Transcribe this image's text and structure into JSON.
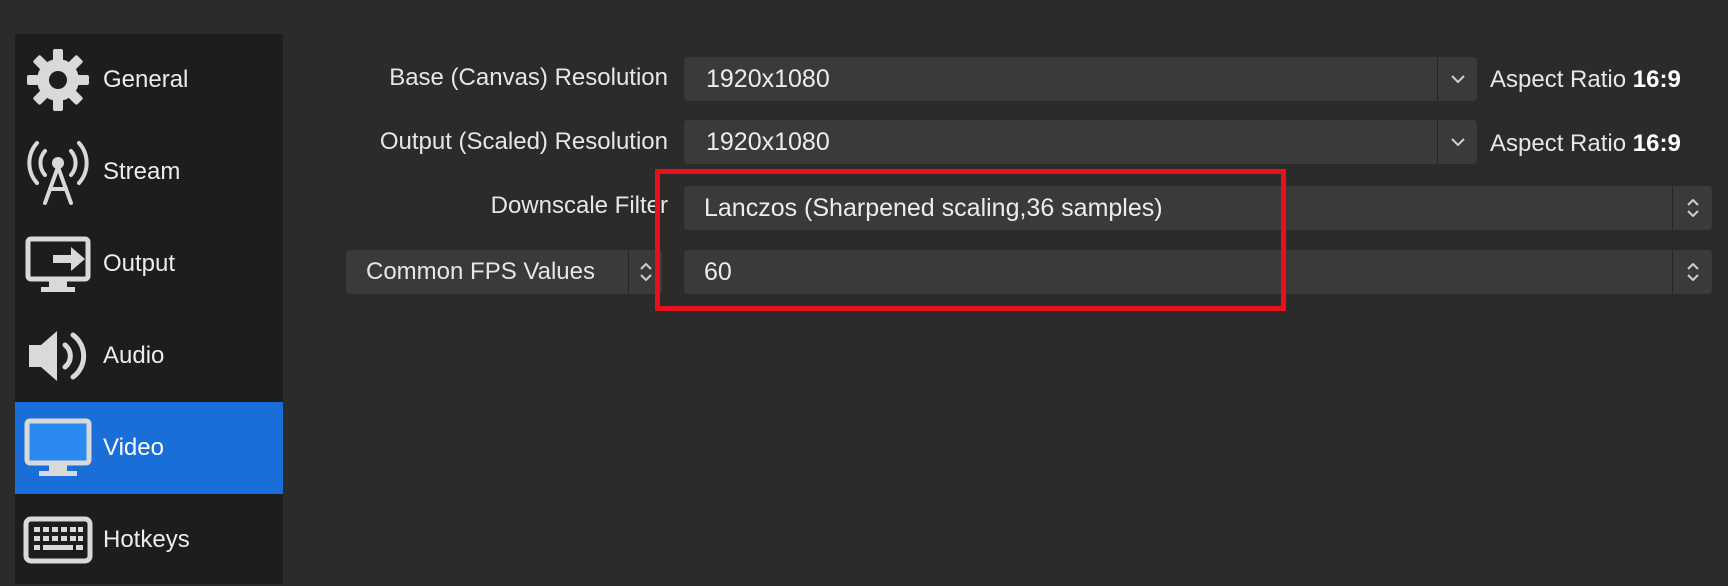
{
  "sidebar": {
    "items": [
      {
        "label": "General",
        "icon": "gear-icon"
      },
      {
        "label": "Stream",
        "icon": "antenna-icon"
      },
      {
        "label": "Output",
        "icon": "output-monitor-icon"
      },
      {
        "label": "Audio",
        "icon": "speaker-icon"
      },
      {
        "label": "Video",
        "icon": "monitor-icon",
        "active": true
      },
      {
        "label": "Hotkeys",
        "icon": "keyboard-icon"
      }
    ]
  },
  "video": {
    "base_resolution": {
      "label": "Base (Canvas) Resolution",
      "value": "1920x1080",
      "aspect_prefix": "Aspect Ratio",
      "aspect_value": "16:9"
    },
    "output_resolution": {
      "label": "Output (Scaled) Resolution",
      "value": "1920x1080",
      "aspect_prefix": "Aspect Ratio",
      "aspect_value": "16:9"
    },
    "downscale_filter": {
      "label": "Downscale Filter",
      "value": "Lanczos (Sharpened scaling,36 samples)"
    },
    "fps": {
      "type_label": "Common FPS Values",
      "value": "60"
    }
  },
  "colors": {
    "background": "#2b2b2b",
    "sidebar": "#1d1d1d",
    "active_item": "#1a6ed8",
    "input": "#3a3a3a",
    "highlight": "#e8101a"
  }
}
